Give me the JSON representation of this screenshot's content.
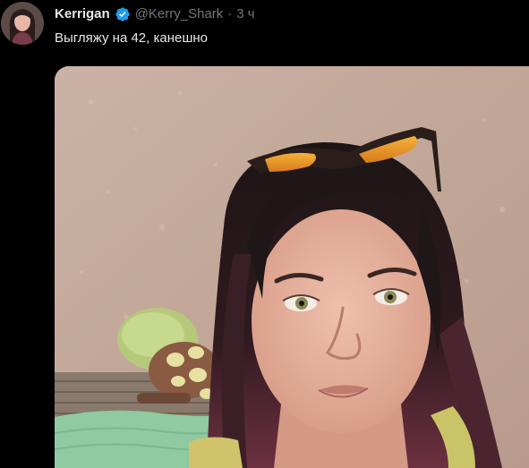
{
  "tweet": {
    "author": {
      "display_name": "Kerrigan",
      "handle": "@Kerry_Shark",
      "verified": true,
      "avatar_icon": "profile-avatar"
    },
    "separator": "·",
    "time": "3 ч",
    "text": "Выгляжу на 42, канешно",
    "media": {
      "type": "photo",
      "subject": "selfie"
    }
  },
  "colors": {
    "background": "#000000",
    "text_primary": "#e7e9ea",
    "text_secondary": "#71767b",
    "verified_blue": "#1d9bf0"
  }
}
